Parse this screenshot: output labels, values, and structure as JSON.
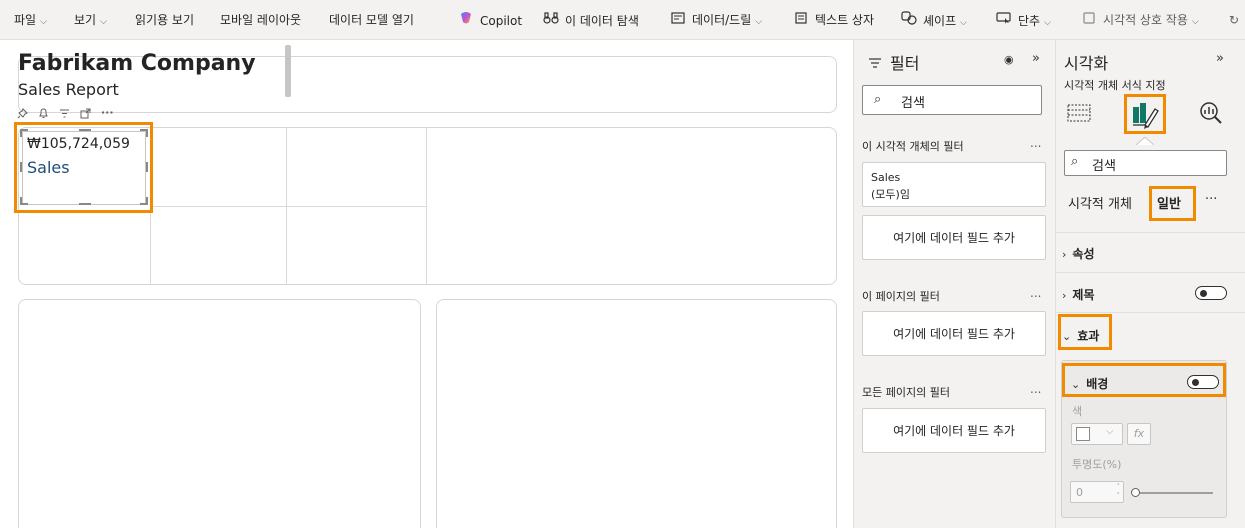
{
  "ribbon": {
    "items": [
      {
        "label": "파일",
        "chevron": true
      },
      {
        "label": "보기",
        "chevron": true
      },
      {
        "label": "읽기용 보기"
      },
      {
        "label": "모바일 레이아웃"
      },
      {
        "label": "데이터 모델 열기"
      },
      {
        "label": "Copilot",
        "icon": "copilot-icon"
      },
      {
        "label": "이 데이터 탐색",
        "icon": "binoculars-icon"
      },
      {
        "label": "데이터/드릴",
        "chevron": true,
        "icon": "drill-icon"
      },
      {
        "label": "텍스트 상자",
        "icon": "textbox-icon"
      },
      {
        "label": "셰이프",
        "chevron": true,
        "icon": "shapes-icon"
      },
      {
        "label": "단추",
        "chevron": true,
        "icon": "button-icon"
      },
      {
        "label": "시각적 상호 작용",
        "chevron": true,
        "icon": "interaction-icon"
      }
    ],
    "refresh_icon": "refresh-icon"
  },
  "report": {
    "title": "Fabrikam Company",
    "subtitle": "Sales Report",
    "kpi": {
      "value": "₩105,724,059",
      "label": "Sales"
    },
    "toolbar_icons": [
      "pin-icon",
      "bell-icon",
      "filter-icon",
      "focus-icon",
      "more-icon"
    ]
  },
  "filters": {
    "title": "필터",
    "search_placeholder": "검색",
    "visual_section": "이 시각적 개체의 필터",
    "visual_filter": {
      "field": "Sales",
      "state": "(모두)임"
    },
    "add_field": "여기에 데이터 필드 추가",
    "page_section": "이 페이지의 필터",
    "all_pages_section": "모든 페이지의 필터",
    "more": "..."
  },
  "viz": {
    "title": "시각화",
    "subtitle": "시각적 개체 서식 지정",
    "search_placeholder": "검색",
    "tab_visual": "시각적 개체",
    "tab_general": "일반",
    "more": "···",
    "sections": {
      "properties": "속성",
      "title": "제목",
      "effects": "효과",
      "background": "배경"
    },
    "background": {
      "color_label": "색",
      "transparency_label": "투명도(%)",
      "transparency_value": "0",
      "fx": "fx"
    }
  },
  "colors": {
    "highlight": "#f08a00",
    "accent_green": "#117865",
    "kpi_label": "#1f4e79"
  }
}
